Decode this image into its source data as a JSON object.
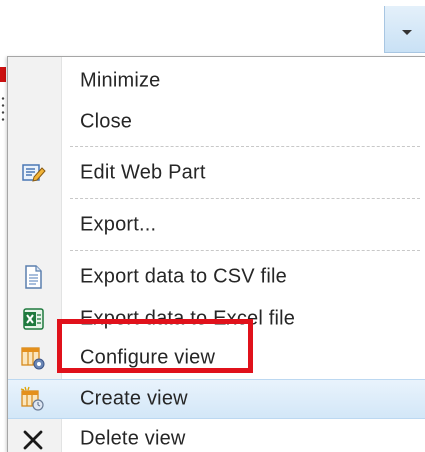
{
  "menu": {
    "items": [
      {
        "label": "Minimize",
        "icon": "none"
      },
      {
        "label": "Close",
        "icon": "none"
      },
      {
        "label": "Edit Web Part",
        "icon": "edit-web-part-icon"
      },
      {
        "label": "Export...",
        "icon": "none"
      },
      {
        "label": "Export data to CSV file",
        "icon": "csv-file-icon"
      },
      {
        "label": "Export data to Excel file",
        "icon": "excel-icon"
      },
      {
        "label": "Configure view",
        "icon": "configure-view-icon"
      },
      {
        "label": "Create view",
        "icon": "create-view-icon",
        "highlighted": true
      },
      {
        "label": "Delete view",
        "icon": "delete-x-icon"
      }
    ]
  },
  "colors": {
    "highlight_box": "#e0111b",
    "hover_background": "#d3e7f8",
    "excel_green": "#1f7a3e"
  }
}
